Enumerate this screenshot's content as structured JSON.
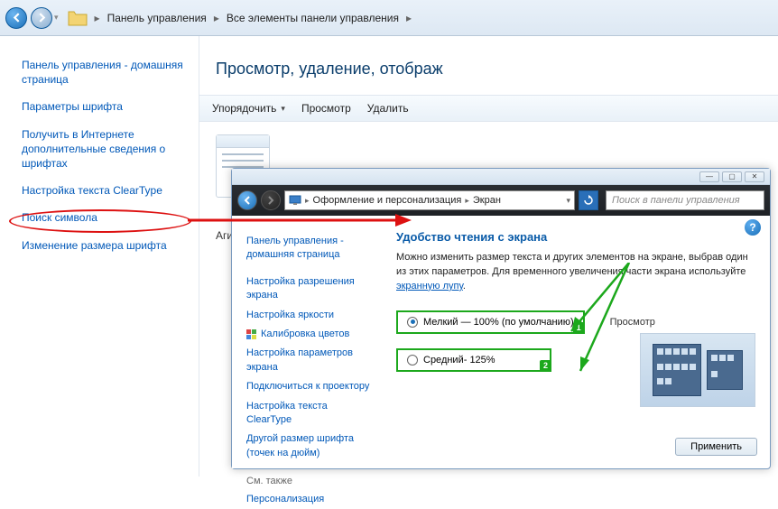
{
  "top": {
    "breadcrumb": [
      "Панель управления",
      "Все элементы панели управления"
    ]
  },
  "sidebar1": {
    "home": "Панель управления - домашняя страница",
    "items": [
      "Параметры шрифта",
      "Получить в Интернете дополнительные сведения о шрифтах",
      "Настройка текста ClearType",
      "Поиск символа",
      "Изменение размера шрифта"
    ]
  },
  "main": {
    "heading": "Просмотр, удаление, отображ",
    "toolbar": {
      "organize": "Упорядочить",
      "view": "Просмотр",
      "delete": "Удалить"
    },
    "pal_letters": "Аги"
  },
  "win2": {
    "addr": {
      "cat": "Оформление и персонализация",
      "page": "Экран"
    },
    "search_placeholder": "Поиск в панели управления",
    "sidebar": {
      "home": "Панель управления - домашняя страница",
      "items": [
        "Настройка разрешения экрана",
        "Настройка яркости",
        "Калибровка цветов",
        "Настройка параметров экрана",
        "Подключиться к проектору",
        "Настройка текста ClearType",
        "Другой размер шрифта (точек на дюйм)"
      ],
      "see_also": "См. также",
      "personalize": "Персонализация"
    },
    "content": {
      "h1": "Удобство чтения с экрана",
      "desc_pre": "Можно изменить размер текста и других элементов на экране, выбрав один из этих параметров. Для временного увеличения части экрана используйте ",
      "desc_link": "экранную лупу",
      "desc_post": ".",
      "radio1": "Мелкий — 100% (по умолчанию)",
      "radio2": "Средний- 125%",
      "preview_label": "Просмотр",
      "apply": "Применить"
    }
  }
}
